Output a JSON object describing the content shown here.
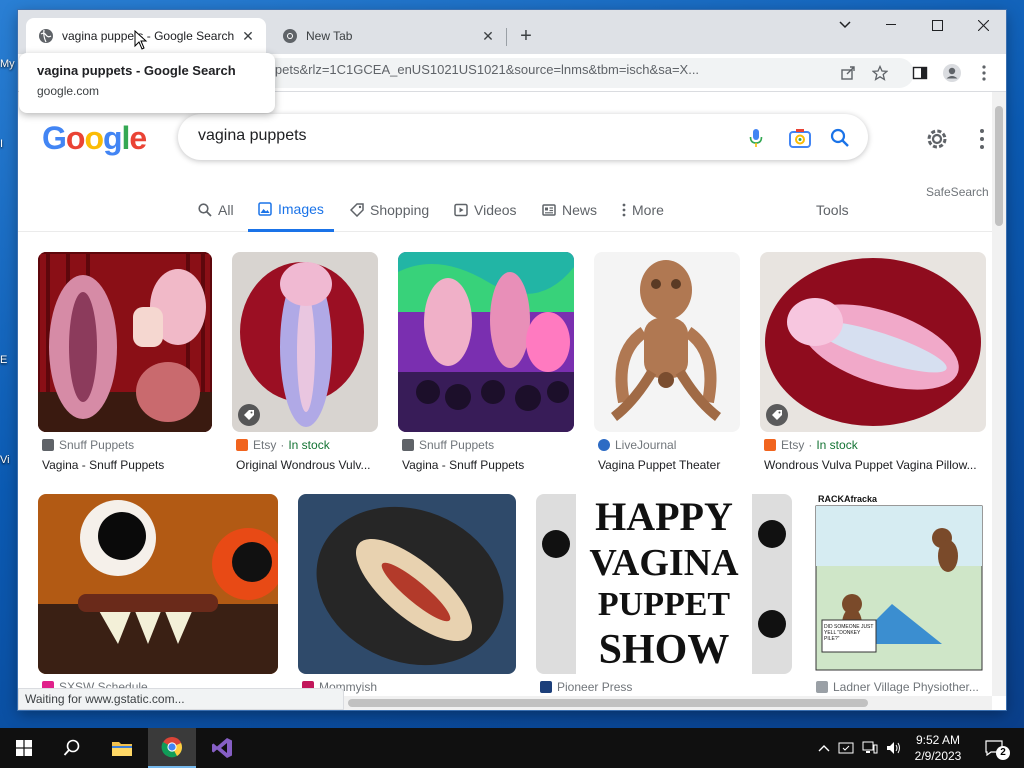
{
  "desktop": {
    "icon_labels": [
      "My",
      "I",
      "E",
      "Vi"
    ]
  },
  "browser": {
    "tabs": [
      {
        "title": "vagina puppets - Google Search",
        "active": true
      },
      {
        "title": "New Tab",
        "active": false
      }
    ],
    "url": "h?q=vagina+puppets&rlz=1C1GCEA_enUS1021US1021&source=lnms&tbm=isch&sa=X...",
    "tooltip": {
      "title": "vagina puppets - Google Search",
      "domain": "google.com"
    },
    "status": "Waiting for www.gstatic.com..."
  },
  "google": {
    "logo": "Google",
    "query": "vagina puppets",
    "tabs": [
      {
        "label": "All",
        "icon": "search-icon"
      },
      {
        "label": "Images",
        "icon": "image-icon",
        "selected": true
      },
      {
        "label": "Shopping",
        "icon": "tag-icon"
      },
      {
        "label": "Videos",
        "icon": "play-icon"
      },
      {
        "label": "News",
        "icon": "news-icon"
      },
      {
        "label": "More",
        "icon": "more-vert-icon"
      }
    ],
    "tools": "Tools",
    "safesearch": "SafeSearch"
  },
  "results": [
    {
      "source": "Snuff Puppets",
      "title": "Vagina - Snuff Puppets",
      "source_icon_color": "#5f6368"
    },
    {
      "source": "Etsy",
      "stock": "In stock",
      "title": "Original Wondrous Vulv...",
      "source_icon_color": "#f1641e"
    },
    {
      "source": "Snuff Puppets",
      "title": "Vagina - Snuff Puppets",
      "source_icon_color": "#5f6368"
    },
    {
      "source": "LiveJournal",
      "title": "Vagina Puppet Theater",
      "source_icon_color": "#2d6bc4"
    },
    {
      "source": "Etsy",
      "stock": "In stock",
      "title": "Wondrous Vulva Puppet Vagina Pillow...",
      "source_icon_color": "#f1641e"
    },
    {
      "source": "SXSW Schedule",
      "title": "",
      "source_icon_color": "#e0218a"
    },
    {
      "source": "Mommyish",
      "title": "",
      "source_icon_color": "#c2185b"
    },
    {
      "source": "Pioneer Press",
      "title": "",
      "source_icon_color": "#1c3f7a"
    },
    {
      "source": "Ladner Village Physiother...",
      "title": "",
      "source_icon_color": "#9aa0a6"
    }
  ],
  "comic": {
    "title": "RACKAfracka",
    "signature": "DID SOMEONE JUST YELL \"DONKEY PILE?\""
  },
  "poster": {
    "lines": [
      "HAPPY",
      "VAGINA",
      "PUPPET",
      "SHOW"
    ]
  },
  "taskbar": {
    "time": "9:52 AM",
    "date": "2/9/2023",
    "notification_count": "2"
  },
  "colors": {
    "google_blue": "#4285f4",
    "google_red": "#ea4335",
    "google_yellow": "#fbbc05",
    "google_green": "#34a853",
    "accent": "#1a73e8"
  }
}
